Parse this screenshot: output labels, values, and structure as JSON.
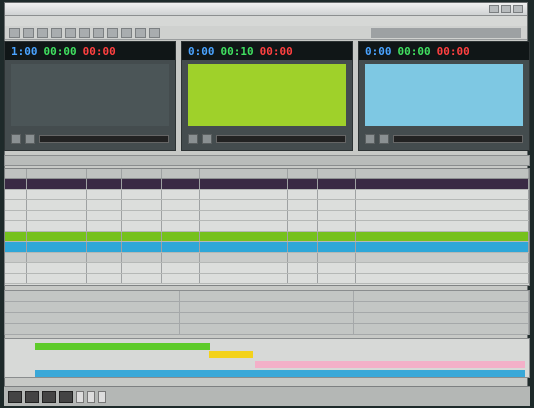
{
  "window": {
    "title": "",
    "center_title": ""
  },
  "menu": [
    "",
    "",
    "",
    "",
    "",
    ""
  ],
  "toolbar_buttons": [
    "",
    "",
    "",
    "",
    "",
    "",
    "",
    "",
    "",
    "",
    ""
  ],
  "decks": [
    {
      "t1": "1:00",
      "t2": "00:00",
      "t3": "00:00",
      "bg": "#4b5557",
      "lines": [
        "",
        "",
        "",
        ""
      ]
    },
    {
      "t1": "0:00",
      "t2": "00:10",
      "t3": "00:00",
      "bg": "#9fd12a",
      "lines": [
        "",
        "",
        "",
        ""
      ]
    },
    {
      "t1": "0:00",
      "t2": "00:00",
      "t3": "00:00",
      "bg": "#7ec8e3",
      "lines": [
        "",
        "",
        "",
        ""
      ]
    }
  ],
  "grid_header": "",
  "table": {
    "columns": [
      "",
      "",
      "",
      "",
      "",
      "",
      "",
      "",
      ""
    ],
    "rows": [
      {
        "bg": "#3a2a44",
        "fg": "#ffffff",
        "cells": [
          "",
          "",
          "",
          "",
          "",
          "",
          "",
          "",
          ""
        ]
      },
      {
        "bg": "#dcdedc",
        "fg": "#222222",
        "cells": [
          "",
          "",
          "",
          "",
          "",
          "",
          "",
          "",
          ""
        ]
      },
      {
        "bg": "#dcdedc",
        "fg": "#222222",
        "cells": [
          "",
          "",
          "",
          "",
          "",
          "",
          "",
          "",
          ""
        ]
      },
      {
        "bg": "#dcdedc",
        "fg": "#222222",
        "cells": [
          "",
          "",
          "",
          "",
          "",
          "",
          "",
          "",
          ""
        ]
      },
      {
        "bg": "#dcdedc",
        "fg": "#222222",
        "cells": [
          "",
          "",
          "",
          "",
          "",
          "",
          "",
          "",
          ""
        ]
      },
      {
        "bg": "#76c11d",
        "fg": "#111111",
        "cells": [
          "",
          "",
          "",
          "",
          "",
          "",
          "",
          "",
          ""
        ]
      },
      {
        "bg": "#2ea7d8",
        "fg": "#111111",
        "cells": [
          "",
          "",
          "",
          "",
          "",
          "",
          "",
          "",
          ""
        ]
      },
      {
        "bg": "#c9cbc9",
        "fg": "#111111",
        "cells": [
          "",
          "",
          "",
          "",
          "",
          "",
          "",
          "",
          ""
        ]
      },
      {
        "bg": "#dcdedc",
        "fg": "#222222",
        "cells": [
          "",
          "",
          "",
          "",
          "",
          "",
          "",
          "",
          ""
        ]
      },
      {
        "bg": "#dcdedc",
        "fg": "#222222",
        "cells": [
          "",
          "",
          "",
          "",
          "",
          "",
          "",
          "",
          ""
        ]
      }
    ]
  },
  "lower_rows": [
    [
      "",
      "",
      ""
    ],
    [
      "",
      "",
      ""
    ],
    [
      "",
      "",
      ""
    ],
    [
      "",
      "",
      ""
    ]
  ],
  "timeline": {
    "segments": [
      {
        "color": "#5ecb2a",
        "text": ""
      },
      {
        "color": "#f3d21a",
        "text": ""
      },
      {
        "color": "#f3b0c8",
        "text": ""
      },
      {
        "color": "#3aa8d8",
        "text": ""
      }
    ]
  },
  "status": {
    "fields": [
      "",
      "",
      ""
    ],
    "logo": ""
  }
}
